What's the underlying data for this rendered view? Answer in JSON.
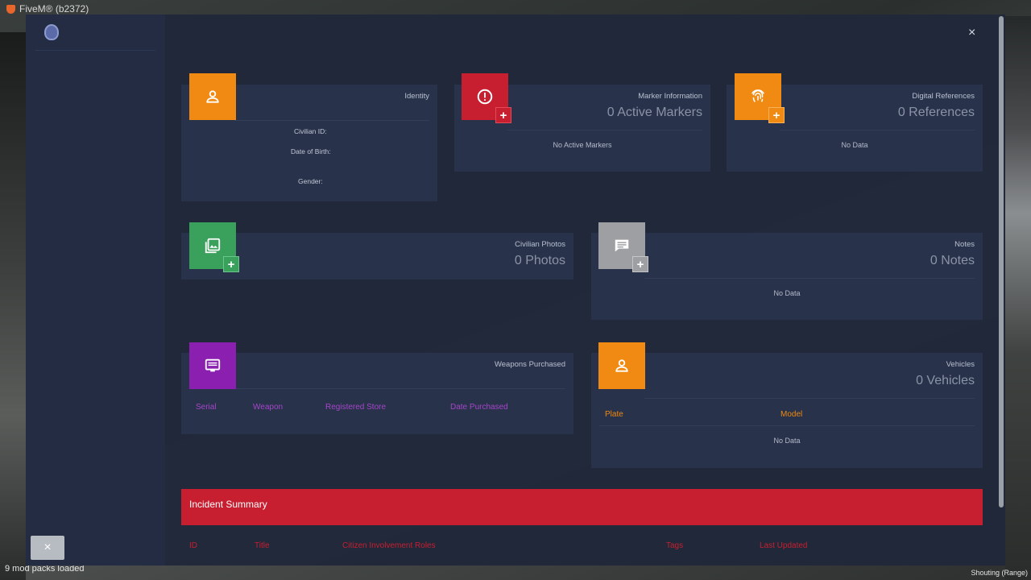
{
  "window": {
    "title": "FiveM® (b2372)"
  },
  "background": {
    "status_text": "9 mod packs loaded",
    "voice_range": "Shouting (Range)"
  },
  "colors": {
    "orange": "#f08a12",
    "red": "#c71f30",
    "green": "#3aa15c",
    "gray": "#9d9fa2",
    "purple": "#8a1fb0",
    "column_header_purple": "#a446c9",
    "column_header_orange": "#f08a12"
  },
  "sidebar": {
    "logo_icon": "police-badge-icon",
    "close_label": "×"
  },
  "header": {
    "close_label": "×"
  },
  "identity": {
    "title": "Identity",
    "icon": "person-icon",
    "fields": {
      "civilian_id": "Civilian ID:",
      "dob": "Date of Birth:",
      "gender": "Gender:"
    }
  },
  "markers": {
    "title": "Marker Information",
    "count": "0 Active Markers",
    "empty": "No Active Markers",
    "icon": "alert-icon",
    "add": "+"
  },
  "digital": {
    "title": "Digital References",
    "count": "0 References",
    "empty": "No Data",
    "icon": "fingerprint-icon",
    "add": "+"
  },
  "photos": {
    "title": "Civilian Photos",
    "count": "0 Photos",
    "icon": "photo-library-icon",
    "add": "+"
  },
  "notes": {
    "title": "Notes",
    "count": "0 Notes",
    "empty": "No Data",
    "icon": "message-icon",
    "add": "+"
  },
  "weapons": {
    "title": "Weapons Purchased",
    "icon": "monitor-icon",
    "columns": [
      "Serial",
      "Weapon",
      "Registered Store",
      "Date Purchased"
    ]
  },
  "vehicles": {
    "title": "Vehicles",
    "count": "0 Vehicles",
    "icon": "person-icon",
    "columns": [
      "Plate",
      "Model"
    ],
    "empty": "No Data"
  },
  "incident": {
    "title": "Incident Summary",
    "columns": [
      "ID",
      "Title",
      "Citizen Involvement Roles",
      "Tags",
      "Last Updated"
    ]
  }
}
